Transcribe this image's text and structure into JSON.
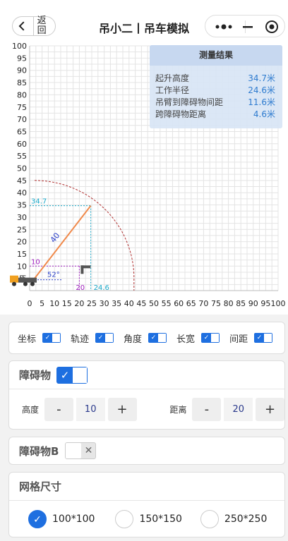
{
  "header": {
    "back_label": "返回",
    "title": "吊小二丨吊车模拟"
  },
  "result": {
    "title": "测量结果",
    "rows": [
      {
        "label": "起升高度",
        "value": "34.7米"
      },
      {
        "label": "工作半径",
        "value": "24.6米"
      },
      {
        "label": "吊臂到障碍物间距",
        "value": "11.6米"
      },
      {
        "label": "跨障碍物距离",
        "value": "4.6米"
      }
    ]
  },
  "chart_data": {
    "type": "scatter",
    "xlim": [
      0,
      100
    ],
    "ylim": [
      0,
      100
    ],
    "x_ticks": [
      0,
      5,
      10,
      15,
      20,
      25,
      30,
      35,
      40,
      45,
      50,
      55,
      60,
      65,
      70,
      75,
      80,
      85,
      90,
      95,
      100
    ],
    "y_ticks": [
      5,
      10,
      15,
      20,
      25,
      30,
      35,
      40,
      45,
      50,
      55,
      60,
      65,
      70,
      75,
      80,
      85,
      90,
      95,
      100
    ],
    "grid": true,
    "boom": {
      "base": [
        2,
        5
      ],
      "tip": [
        24.6,
        34.7
      ],
      "length_label": "40",
      "angle_label": "52°"
    },
    "arc_radius": 40,
    "obstacle": {
      "x": 20,
      "height": 10
    },
    "annotations": {
      "height_label": "34.7",
      "radius_label": "24.6",
      "obstacle_h_label": "10",
      "obstacle_x_label": "20",
      "origin_y_label": "5"
    },
    "colors": {
      "boom": "#f0894a",
      "arc": "#b03030",
      "guide": "#19a8c8",
      "obstacle_guide": "#a020c0",
      "angle": "#2a3fc8"
    }
  },
  "toggles": [
    {
      "label": "坐标",
      "on": true
    },
    {
      "label": "轨迹",
      "on": true
    },
    {
      "label": "角度",
      "on": true
    },
    {
      "label": "长宽",
      "on": true
    },
    {
      "label": "间距",
      "on": true
    }
  ],
  "obstacle": {
    "title": "障碍物",
    "height_label": "高度",
    "height_value": "10",
    "distance_label": "距离",
    "distance_value": "20",
    "minus": "-",
    "plus": "+"
  },
  "obstacle_b": {
    "title": "障碍物B",
    "off_mark": "✕"
  },
  "grid_size": {
    "title": "网格尺寸",
    "options": [
      "100*100",
      "150*150",
      "250*250"
    ],
    "selected": "100*100"
  }
}
